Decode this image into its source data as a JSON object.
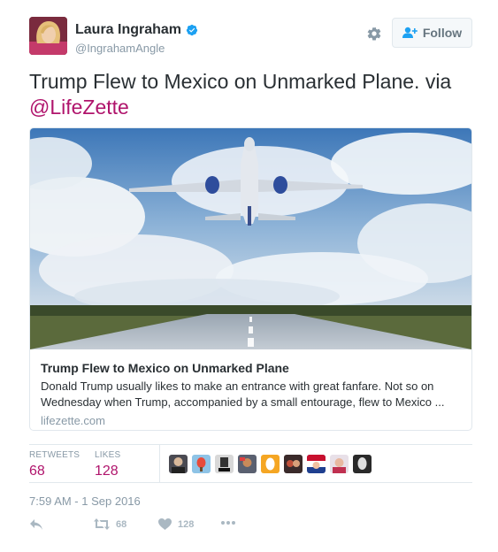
{
  "author": {
    "name": "Laura Ingraham",
    "handle": "@IngrahamAngle",
    "verified": true
  },
  "follow_label": "Follow",
  "tweet": {
    "text": "Trump Flew to Mexico on Unmarked Plane. via",
    "mention": "@LifeZette"
  },
  "card": {
    "title": "Trump Flew to Mexico on Unmarked Plane",
    "description": "Donald Trump usually likes to make an entrance with great fanfare. Not so on Wednesday when Trump, accompanied by a small entourage, flew to Mexico ...",
    "domain": "lifezette.com"
  },
  "stats": {
    "retweets_label": "RETWEETS",
    "retweets_value": "68",
    "likes_label": "LIKES",
    "likes_value": "128"
  },
  "timestamp": "7:59 AM - 1 Sep 2016",
  "actions": {
    "retweet_count": "68",
    "like_count": "128"
  },
  "colors": {
    "accent": "#b0146c",
    "verified": "#1da1f2",
    "muted": "#8899a6"
  },
  "icons": [
    "gear-icon",
    "follow-person-plus-icon",
    "verified-badge-icon",
    "reply-icon",
    "retweet-icon",
    "heart-icon",
    "more-dots-icon"
  ]
}
